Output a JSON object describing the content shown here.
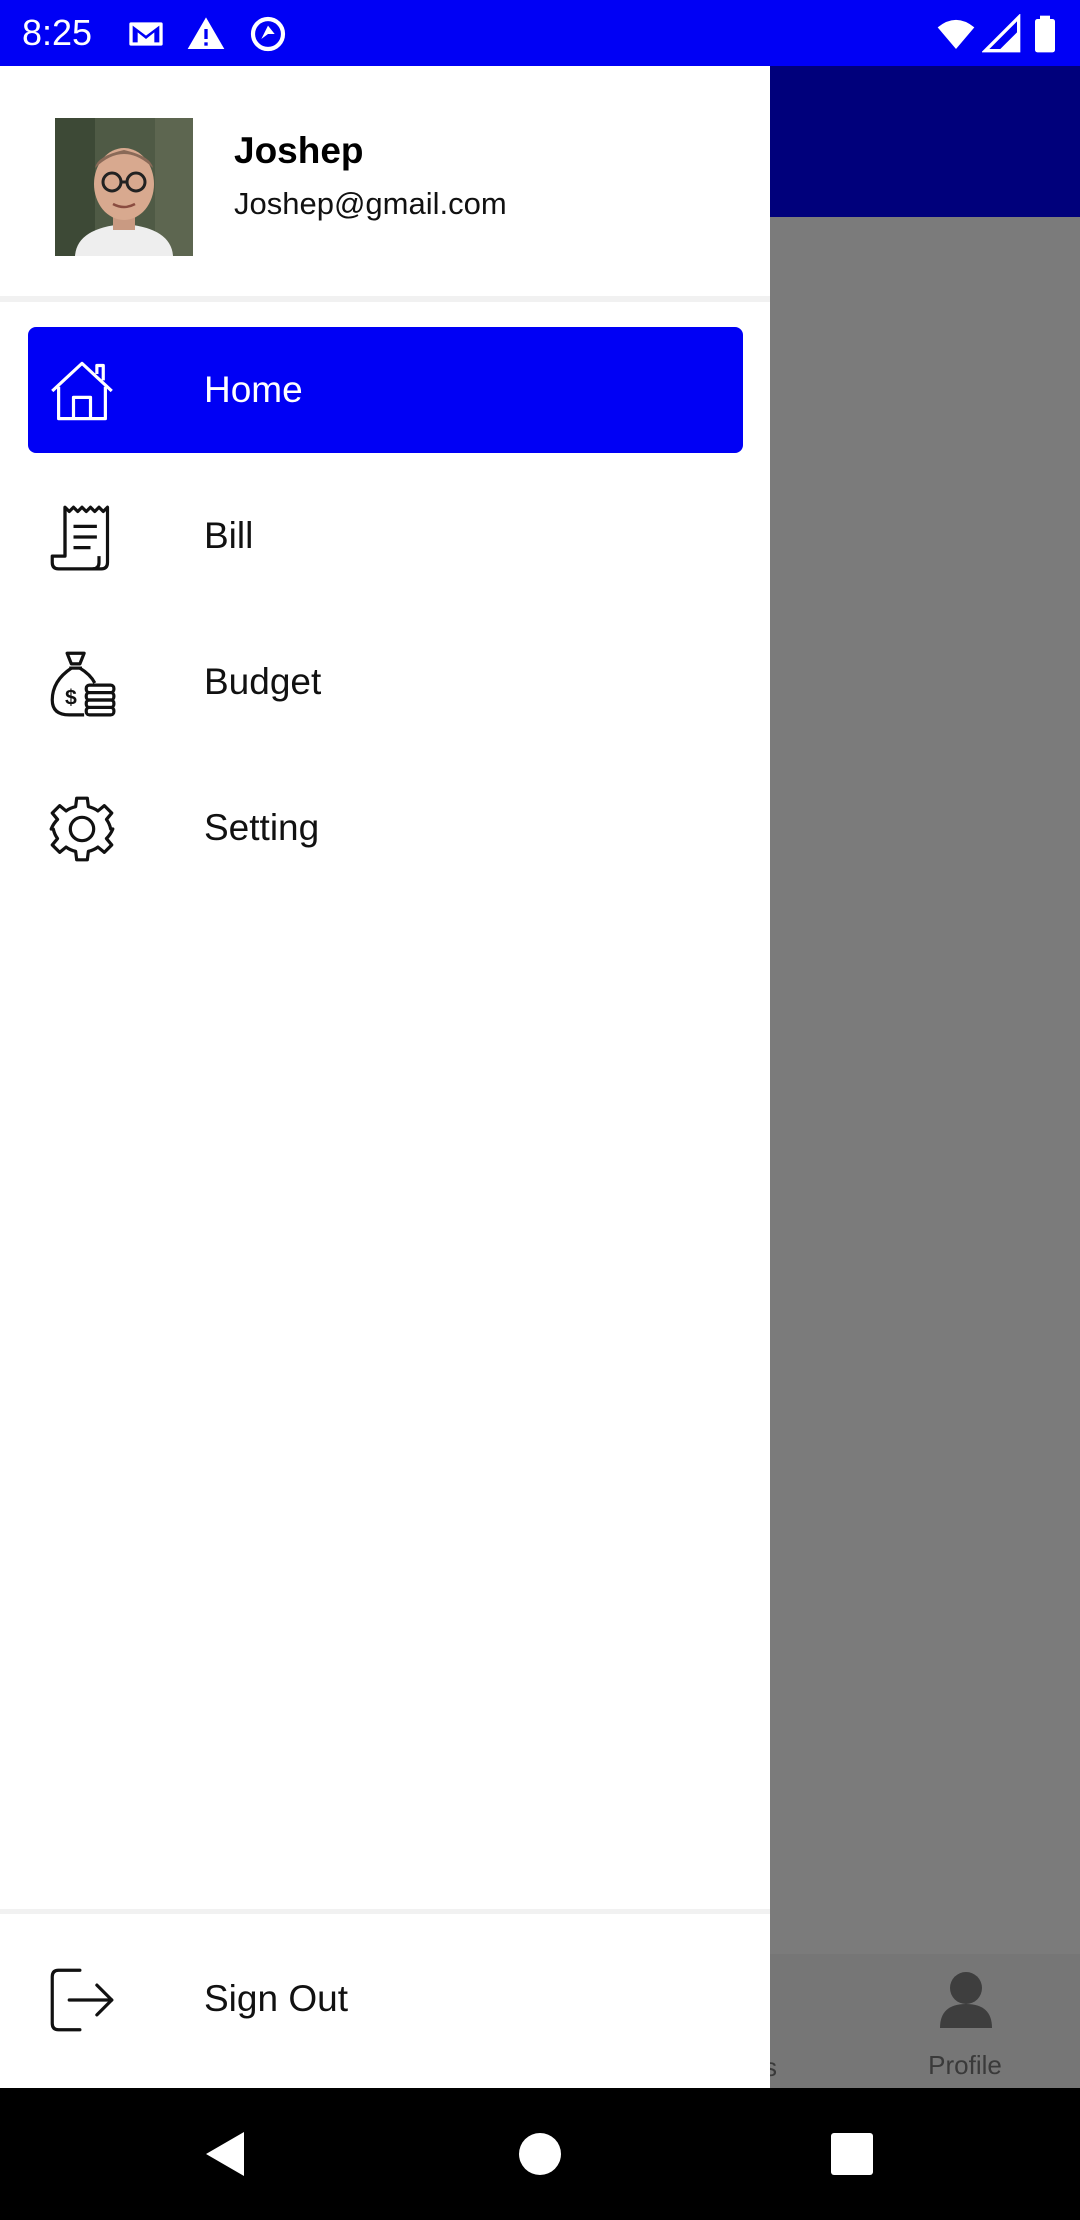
{
  "status_bar": {
    "time": "8:25",
    "left_icons": [
      "gmail-icon",
      "warning-icon",
      "sync-icon"
    ],
    "right_icons": [
      "wifi-icon",
      "signal-icon",
      "battery-icon"
    ]
  },
  "background_app": {
    "bottom_nav": {
      "partial_label": "s",
      "profile_label": "Profile"
    }
  },
  "drawer": {
    "user": {
      "name": "Joshep",
      "email": "Joshep@gmail.com"
    },
    "items": [
      {
        "label": "Home",
        "icon": "home-icon",
        "active": true
      },
      {
        "label": "Bill",
        "icon": "receipt-icon",
        "active": false
      },
      {
        "label": "Budget",
        "icon": "money-bag-icon",
        "active": false
      },
      {
        "label": "Setting",
        "icon": "gear-icon",
        "active": false
      }
    ],
    "sign_out": {
      "label": "Sign Out",
      "icon": "logout-icon"
    }
  },
  "nav_bar": {
    "buttons": [
      "back-icon",
      "home-circle-icon",
      "recents-icon"
    ]
  },
  "colors": {
    "primary": "#0000f5",
    "toolbar": "#00007b",
    "scrim": "#7b7b7b"
  }
}
